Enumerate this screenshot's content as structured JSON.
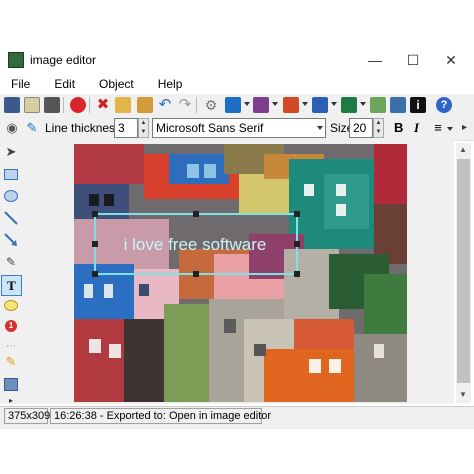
{
  "window": {
    "title": "image editor",
    "icon": "app-icon"
  },
  "menu": [
    "File",
    "Edit",
    "Object",
    "Help"
  ],
  "toolbar": {
    "line_thickness_label": "Line thickness",
    "line_thickness_value": "3",
    "font_family": "Microsoft Sans Serif",
    "size_label": "Size",
    "size_value": "20",
    "bold": "B",
    "italic": "I"
  },
  "canvas": {
    "text_object": "i love free software",
    "text_color": "#c8f5f8"
  },
  "status": {
    "dimensions": "375x309",
    "message": "16:26:38 - Exported to: Open in image editor"
  },
  "colors": {
    "accent": "#0078d7",
    "selection": "#7fe0e6"
  }
}
